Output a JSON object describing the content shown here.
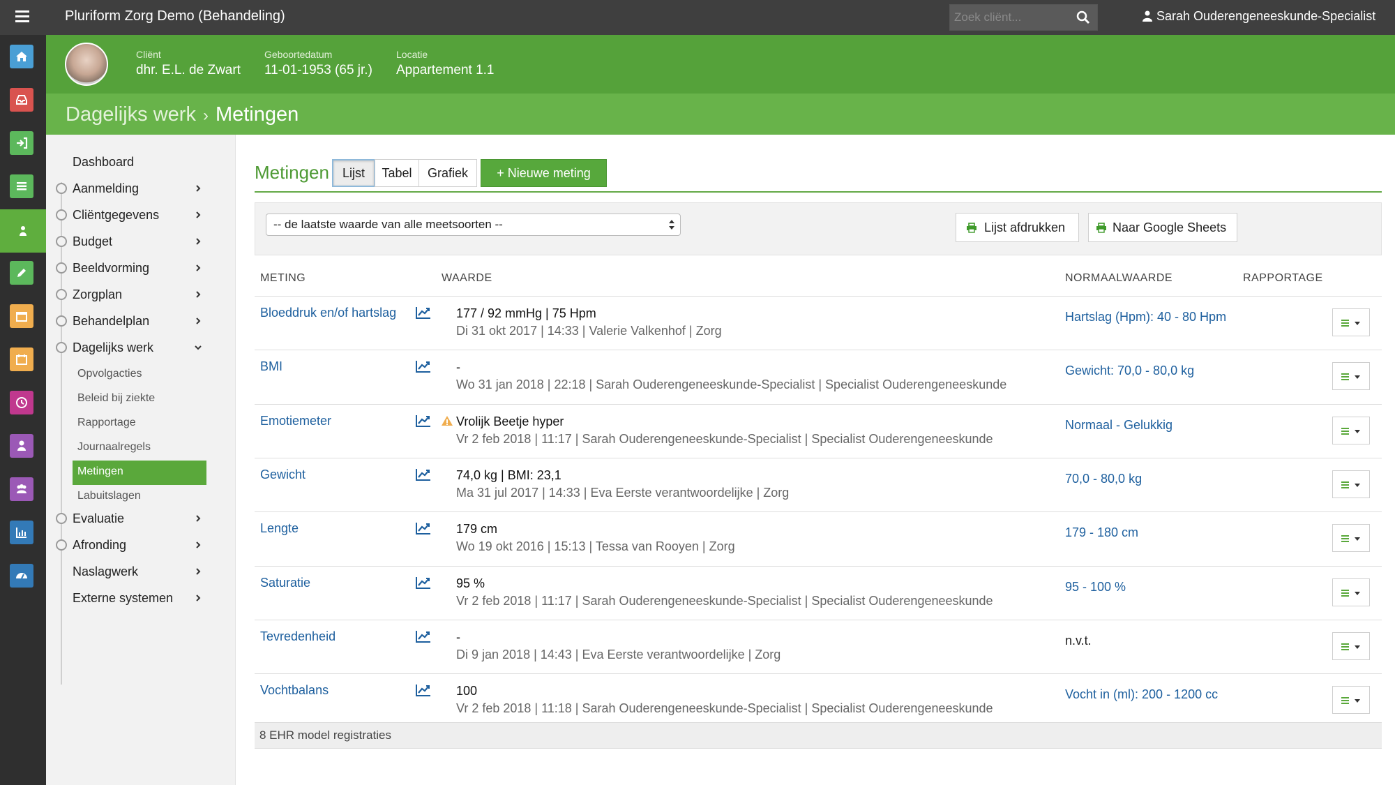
{
  "app": {
    "title": "Pluriform Zorg Demo  (Behandeling)",
    "search_placeholder": "Zoek cliënt...",
    "user": "Sarah Ouderengeneeskunde-Specialist"
  },
  "client": {
    "client_label": "Cliënt",
    "client_value": "dhr. E.L. de Zwart",
    "dob_label": "Geboortedatum",
    "dob_value": "11-01-1953 (65 jr.)",
    "location_label": "Locatie",
    "location_value": "Appartement 1.1"
  },
  "breadcrumb": {
    "parent": "Dagelijks werk",
    "separator": "›",
    "current": "Metingen"
  },
  "rail": {
    "icons": [
      "home-icon",
      "inbox-icon",
      "sign-in-icon",
      "list-icon",
      "user-add-icon",
      "pencil-icon",
      "calendar-icon",
      "calendar-alt-icon",
      "clock-icon",
      "user-icon",
      "group-icon",
      "bar-chart-icon",
      "dashboard-icon"
    ],
    "colors": [
      "#4a9fd5",
      "#d9534f",
      "#5cb85c",
      "#5cb85c",
      "#5cb85c",
      "#5cb85c",
      "#f0ad4e",
      "#f0ad4e",
      "#c0388e",
      "#9b59b6",
      "#9b59b6",
      "#337ab7",
      "#337ab7"
    ]
  },
  "nav": {
    "items": [
      {
        "label": "Dashboard"
      },
      {
        "label": "Aanmelding"
      },
      {
        "label": "Cliëntgegevens"
      },
      {
        "label": "Budget"
      },
      {
        "label": "Beeldvorming"
      },
      {
        "label": "Zorgplan"
      },
      {
        "label": "Behandelplan"
      },
      {
        "label": "Dagelijks werk"
      },
      {
        "label": "Evaluatie"
      },
      {
        "label": "Afronding"
      },
      {
        "label": "Naslagwerk"
      },
      {
        "label": "Externe systemen"
      }
    ],
    "sub": [
      "Opvolgacties",
      "Beleid bij ziekte",
      "Rapportage",
      "Journaalregels",
      "Metingen",
      "Labuitslagen"
    ]
  },
  "main": {
    "title": "Metingen",
    "tabs": [
      "Lijst",
      "Tabel",
      "Grafiek"
    ],
    "new_button": "+ Nieuwe meting",
    "filter_value": "-- de laatste waarde van alle meetsoorten --",
    "print_button": "Lijst afdrukken",
    "sheets_button": "Naar Google Sheets"
  },
  "table": {
    "headers": [
      "METING",
      "WAARDE",
      "NORMAALWAARDE",
      "RAPPORTAGE"
    ],
    "rows": [
      {
        "name": "Bloeddruk en/of hartslag",
        "value": "177 / 92 mmHg | 75 Hpm",
        "meta": "Di 31 okt 2017 | 14:33 | Valerie Valkenhof | Zorg",
        "norm": "Hartslag (Hpm): 40 - 80 Hpm"
      },
      {
        "name": "BMI",
        "value": "-",
        "meta": "Wo 31 jan 2018 | 22:18 | Sarah Ouderengeneeskunde-Specialist | Specialist Ouderengeneeskunde",
        "norm": "Gewicht: 70,0 - 80,0 kg"
      },
      {
        "name": "Emotiemeter",
        "value": "Vrolijk Beetje hyper",
        "meta": "Vr 2 feb 2018 | 11:17 | Sarah Ouderengeneeskunde-Specialist | Specialist Ouderengeneeskunde",
        "norm": "Normaal - Gelukkig"
      },
      {
        "name": "Gewicht",
        "value": "74,0 kg | BMI: 23,1",
        "meta": "Ma 31 jul 2017 | 14:33 | Eva Eerste verantwoordelijke | Zorg",
        "norm": "70,0 - 80,0 kg"
      },
      {
        "name": "Lengte",
        "value": "179 cm",
        "meta": "Wo 19 okt 2016 | 15:13 | Tessa van Rooyen | Zorg",
        "norm": "179 - 180 cm"
      },
      {
        "name": "Saturatie",
        "value": "95 %",
        "meta": "Vr 2 feb 2018 | 11:17 | Sarah Ouderengeneeskunde-Specialist | Specialist Ouderengeneeskunde",
        "norm": "95 - 100 %"
      },
      {
        "name": "Tevredenheid",
        "value": "-",
        "meta": "Di 9 jan 2018 | 14:43 | Eva Eerste verantwoordelijke | Zorg",
        "norm": "n.v.t."
      },
      {
        "name": "Vochtbalans",
        "value": "100",
        "meta": "Vr 2 feb 2018 | 11:18 | Sarah Ouderengeneeskunde-Specialist | Specialist Ouderengeneeskunde",
        "norm": "Vocht in (ml): 200 - 1200 cc"
      }
    ],
    "footer": "8 EHR model registraties"
  },
  "colors": {
    "brand_green": "#55a23a",
    "link_blue": "#1d5f9e",
    "topbar": "#3f3f3f"
  }
}
